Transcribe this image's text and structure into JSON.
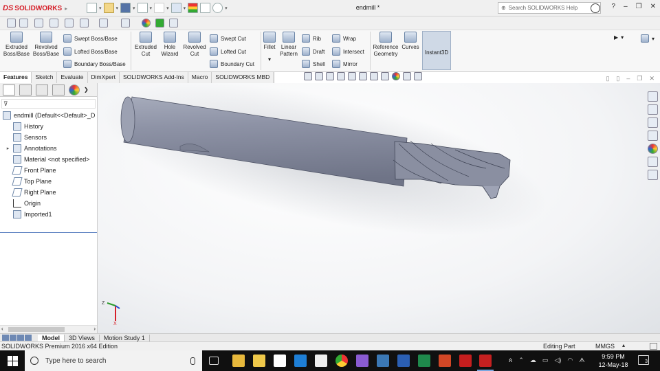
{
  "app": {
    "brand_prefix": "DS",
    "brand": "SOLIDWORKS",
    "document_title": "endmill *"
  },
  "search": {
    "placeholder": "Search SOLIDWORKS Help"
  },
  "window_controls": [
    "?",
    "–",
    "❐",
    "✕"
  ],
  "ribbon": {
    "big_buttons": [
      {
        "label1": "Extruded",
        "label2": "Boss/Base",
        "icon": "extruded-boss-icon"
      },
      {
        "label1": "Revolved",
        "label2": "Boss/Base",
        "icon": "revolved-boss-icon"
      },
      {
        "label1": "Extruded",
        "label2": "Cut",
        "icon": "extruded-cut-icon"
      },
      {
        "label1": "Hole",
        "label2": "Wizard",
        "icon": "hole-wizard-icon"
      },
      {
        "label1": "Revolved",
        "label2": "Cut",
        "icon": "revolved-cut-icon"
      },
      {
        "label1": "Fillet",
        "label2": "",
        "icon": "fillet-icon"
      },
      {
        "label1": "Linear",
        "label2": "Pattern",
        "icon": "linear-pattern-icon"
      },
      {
        "label1": "Reference",
        "label2": "Geometry",
        "icon": "reference-geometry-icon"
      },
      {
        "label1": "Curves",
        "label2": "",
        "icon": "curves-icon"
      }
    ],
    "small_buttons": {
      "swept_boss": "Swept Boss/Base",
      "lofted_boss": "Lofted Boss/Base",
      "boundary_boss": "Boundary Boss/Base",
      "swept_cut": "Swept Cut",
      "lofted_cut": "Lofted Cut",
      "boundary_cut": "Boundary Cut",
      "rib": "Rib",
      "draft": "Draft",
      "shell": "Shell",
      "wrap": "Wrap",
      "intersect": "Intersect",
      "mirror": "Mirror"
    },
    "instant3d": "Instant3D"
  },
  "command_tabs": [
    "Features",
    "Sketch",
    "Evaluate",
    "DimXpert",
    "SOLIDWORKS Add-Ins",
    "Macro",
    "SOLIDWORKS MBD"
  ],
  "feature_tree": {
    "root": "endmill  (Default<<Default>_D",
    "items": [
      "History",
      "Sensors",
      "Annotations",
      "Material <not specified>",
      "Front Plane",
      "Top Plane",
      "Right Plane",
      "Origin",
      "Imported1"
    ]
  },
  "bottom_tabs": [
    "Model",
    "3D Views",
    "Motion Study 1"
  ],
  "status_bar": {
    "edition": "SOLIDWORKS Premium 2016 x64 Edition",
    "mode": "Editing Part",
    "units": "MMGS"
  },
  "taskbar": {
    "search_placeholder": "Type here to search",
    "time": "9:59 PM",
    "date": "12-May-18",
    "notifications": "3"
  },
  "colors": {
    "brand_red": "#d6202a",
    "part_gray": "#8c91a3",
    "accent_blue": "#5a7fc0",
    "taskbar": "#101010"
  }
}
